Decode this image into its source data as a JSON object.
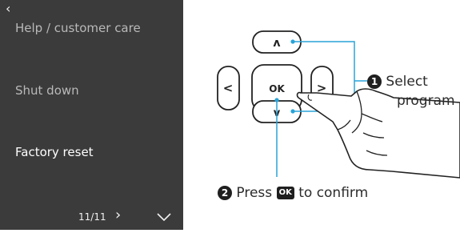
{
  "menu": {
    "back_icon": "back-arrow-icon",
    "items": [
      {
        "label": "Help / customer care"
      },
      {
        "label": "Shut down"
      },
      {
        "label": "Factory reset"
      }
    ],
    "pager": "11/11",
    "next_icon": "chevron-right-icon",
    "down_icon": "chevron-down-icon"
  },
  "remote": {
    "up": "ʌ",
    "left": "<",
    "ok": "OK",
    "right": ">",
    "down": "v"
  },
  "steps": {
    "step1_number": "1",
    "step1_line1": "Select",
    "step1_line2": "program",
    "step2_number": "2",
    "step2_prefix": "Press",
    "step2_ok": "OK",
    "step2_suffix": "to confirm"
  },
  "colors": {
    "panel_bg": "#3b3b3b",
    "accent_lines": "#29a3d8",
    "text_dark": "#2b2b2b"
  }
}
